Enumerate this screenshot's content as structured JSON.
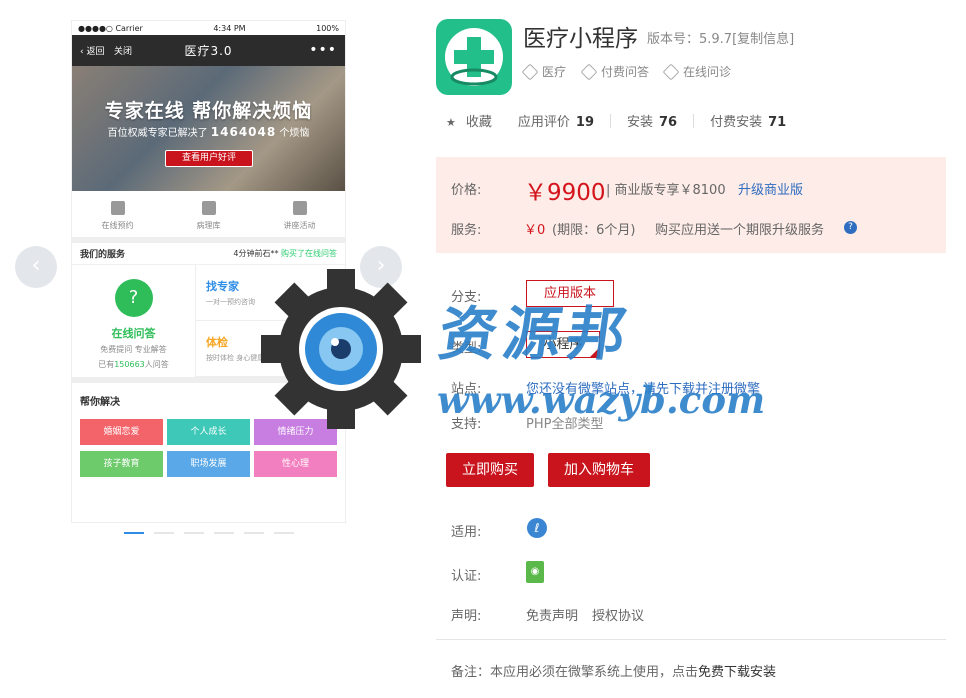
{
  "phone": {
    "carrier": "●●●●○ Carrier",
    "time": "4:34 PM",
    "battery": "100%",
    "back": "‹ 返回",
    "close": "关闭",
    "title": "医疗3.0",
    "more": "•••",
    "banner_title": "专家在线 帮你解决烦恼",
    "banner_sub_pre": "百位权威专家已解决了",
    "banner_count": "1464048",
    "banner_sub_post": "个烦恼",
    "banner_btn": "查看用户好评",
    "qnav": [
      "在线预约",
      "病理库",
      "讲座活动"
    ],
    "services_head": "我们的服务",
    "services_marquee_pre": "4分钟前石**",
    "services_marquee_post": "购买了在线问答",
    "online_qa": "在线问答",
    "online_qa_sub": "免费提问 专业解答",
    "online_qa_count_pre": "已有",
    "online_qa_count": "150663",
    "online_qa_count_post": "人问答",
    "find_expert": "找专家",
    "find_expert_sub": "一对一预约咨询",
    "checkup": "体检",
    "checkup_sub": "按时体检 身心健康",
    "help_head": "帮你解决",
    "help_tags": [
      "婚姻恋爱",
      "个人成长",
      "情绪压力",
      "孩子教育",
      "职场发展",
      "性心理"
    ],
    "help_colors": [
      "#f3636a",
      "#3dc8b8",
      "#c77ee0",
      "#6ecb6c",
      "#5aa8e8",
      "#f27fbf"
    ]
  },
  "app": {
    "name": "医疗小程序",
    "version": "版本号：5.9.7[复制信息]",
    "tags": [
      "医疗",
      "付费问答",
      "在线问诊"
    ],
    "favorite": "收藏",
    "rating_label": "应用评价",
    "rating": "19",
    "install_label": "安装",
    "install": "76",
    "paid_install_label": "付费安装",
    "paid_install": "71"
  },
  "price": {
    "price_label": "价格:",
    "price": "￥9900",
    "biz_text": "| 商业版专享￥8100",
    "upgrade": "升级商业版",
    "service_label": "服务:",
    "service_price": "￥0",
    "service_period": "(期限：6个月)",
    "service_desc": "购买应用送一个期限升级服务"
  },
  "details": {
    "branch_label": "分支:",
    "branch_value": "应用版本",
    "type_label": "类型:",
    "type_value": "小程序",
    "site_label": "站点:",
    "site_value": "您还没有微擎站点，请先下载并注册微擎",
    "support_label": "支持:",
    "support_value": "PHP全部类型",
    "buy_now": "立即购买",
    "add_cart": "加入购物车",
    "apply_label": "适用:",
    "cert_label": "认证:",
    "statement_label": "声明:",
    "disclaimer": "免责声明",
    "license": "授权协议",
    "note_pre": "备注：本应用必须在微擎系统上使用，点击",
    "note_link": "免费下载安装"
  },
  "watermark": {
    "cn": "资源邦",
    "url": "www.wazyb.com"
  }
}
